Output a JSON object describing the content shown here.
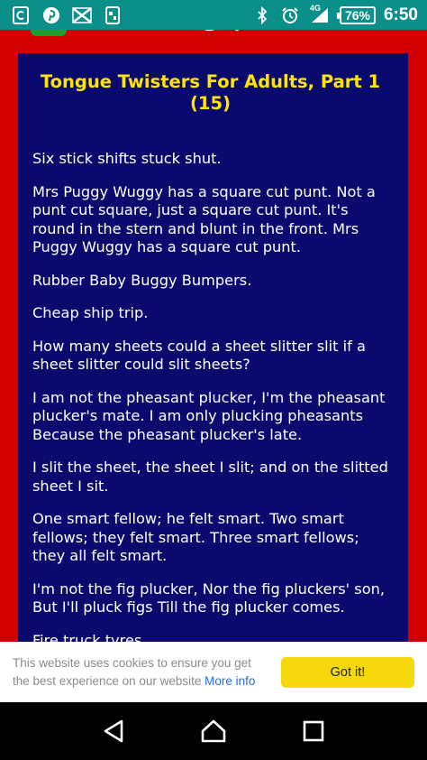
{
  "status_bar": {
    "icons": [
      "ccleaner-icon",
      "pinterest-icon",
      "messenger-icon",
      "sim-manager-icon"
    ],
    "network_type": "4G",
    "battery": "76%",
    "time": "6:50"
  },
  "article": {
    "title": "Tongue Twisters For Adults, Part 1 (15)",
    "paragraphs": [
      "Six stick shifts stuck shut.",
      "Mrs Puggy Wuggy has a square cut punt. Not a punt cut square, just a square cut punt. It's round in the stern and blunt in the front. Mrs Puggy Wuggy has a square cut punt.",
      "Rubber Baby Buggy Bumpers.",
      "Cheap ship trip.",
      "How many sheets could a sheet slitter slit if a sheet slitter could slit sheets?",
      "I am not the pheasant plucker, I'm the pheasant plucker's mate. I am only plucking pheasants Because the pheasant plucker's late.",
      "I slit the sheet, the sheet I slit; and on the slitted sheet I sit.",
      "One smart fellow; he felt smart. Two smart fellows; they felt smart. Three smart fellows; they all felt smart.",
      "I'm not the fig plucker, Nor the fig pluckers' son, But I'll pluck figs Till the fig plucker comes.",
      "Fire truck tyres"
    ]
  },
  "cookie_banner": {
    "message": "This website uses cookies to ensure you get the best experience on our website",
    "more_info": "More info",
    "button_label": "Got it!"
  },
  "nav_bar": {
    "icons": [
      "back-icon",
      "home-icon",
      "recents-icon"
    ]
  },
  "colors": {
    "status_bar": "#0a8f8a",
    "page_background": "#d40000",
    "panel_background": "#0a0a6e",
    "title": "#ffe400",
    "button": "#f6d90c",
    "link": "#2a6fd6"
  }
}
